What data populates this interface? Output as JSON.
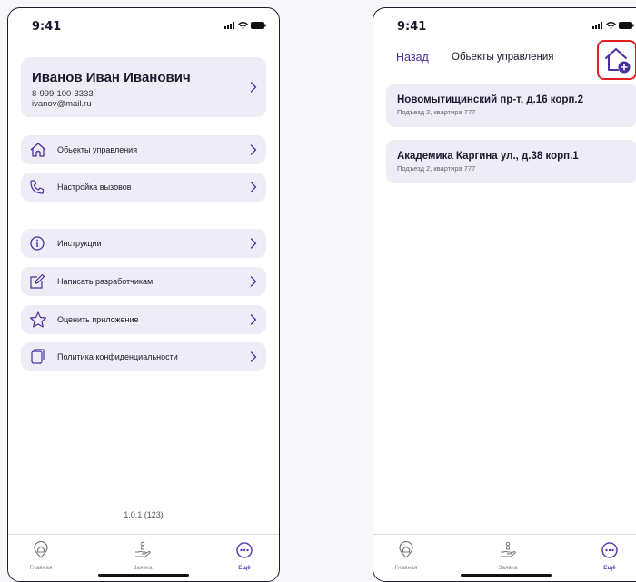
{
  "status": {
    "time": "9:41"
  },
  "profile": {
    "name": "Иванов Иван Иванович",
    "phone": "8-999-100-3333",
    "email": "ivanov@mail.ru"
  },
  "menu": {
    "objects": "Обьекты управления",
    "calls": "Настройка вызовов",
    "instructions": "Инструкции",
    "write_devs": "Написать разработчикам",
    "rate_app": "Оценить приложение",
    "privacy": "Политика конфиденциальности"
  },
  "version": "1.0.1 (123)",
  "tabbar": {
    "home": "Главная",
    "request": "Заявка",
    "more": "Ещё"
  },
  "objects_screen": {
    "back": "Назад",
    "title": "Обьекты управления",
    "items": [
      {
        "title": "Новомытищинский пр-т, д.16 корп.2",
        "subtitle": "Подъезд 2, квартира 777"
      },
      {
        "title": "Академика Каргина ул., д.38 корп.1",
        "subtitle": "Подъезд 2, квартира 777"
      }
    ]
  },
  "colors": {
    "accent": "#5b3fb8",
    "card": "#eeedf7",
    "highlight": "#e02020"
  },
  "icons": [
    "signal-icon",
    "wifi-icon",
    "battery-icon",
    "chevron-right-icon",
    "house-icon",
    "phone-icon",
    "info-icon",
    "edit-icon",
    "star-icon",
    "document-icon",
    "house-location-icon",
    "hand-request-icon",
    "more-dots-icon",
    "house-add-icon"
  ]
}
